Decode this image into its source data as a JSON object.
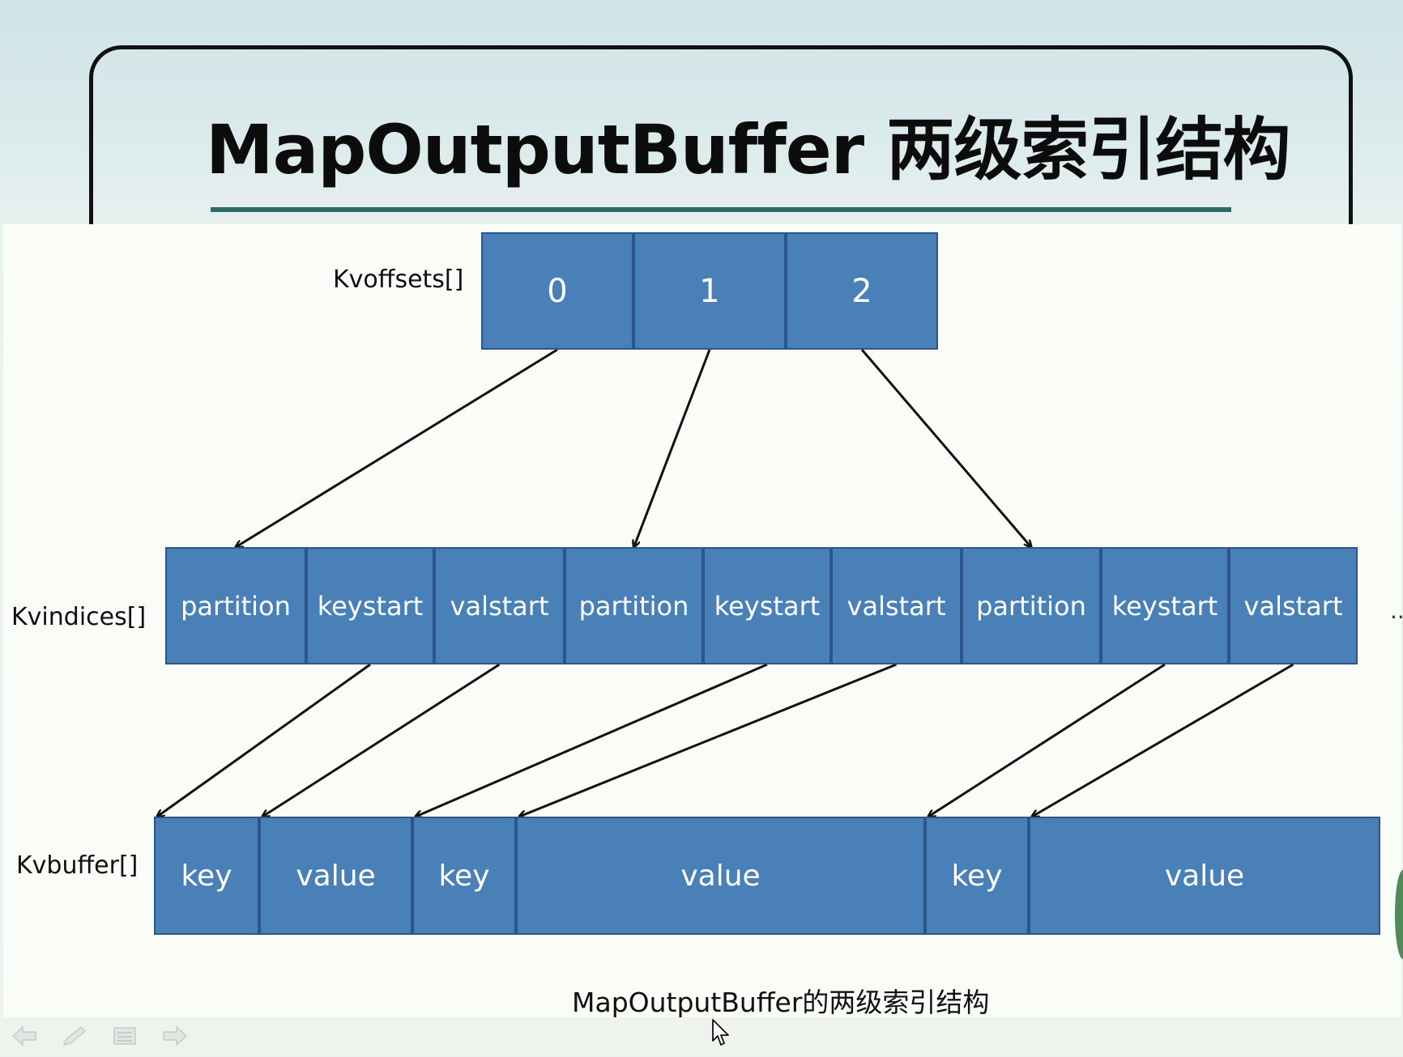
{
  "slide": {
    "title": "MapOutputBuffer 两级索引结构",
    "caption": "MapOutputBuffer的两级索引结构"
  },
  "diagram": {
    "kvoffsets": {
      "label": "Kvoffsets[]",
      "cells": [
        "0",
        "1",
        "2"
      ]
    },
    "kvindices": {
      "label": "Kvindices[]",
      "cells": [
        "partition",
        "keystart",
        "valstart",
        "partition",
        "keystart",
        "valstart",
        "partition",
        "keystart",
        "valstart"
      ],
      "continuation": "..."
    },
    "kvbuffer": {
      "label": "Kvbuffer[]",
      "cells": [
        "key",
        "value",
        "key",
        "value",
        "key",
        "value"
      ]
    },
    "links_offsets_to_indices": [
      [
        0,
        0
      ],
      [
        1,
        3
      ],
      [
        2,
        6
      ]
    ],
    "links_indices_to_buffer": [
      [
        1,
        0
      ],
      [
        2,
        1
      ],
      [
        4,
        2
      ],
      [
        5,
        3
      ],
      [
        7,
        4
      ],
      [
        8,
        5
      ]
    ]
  },
  "icons": {
    "nav": [
      "arrow-left-icon",
      "pen-icon",
      "menu-icon",
      "arrow-right-icon"
    ],
    "pointer": "mouse-cursor-icon"
  },
  "colors": {
    "cell_fill": "#4a80b8",
    "cell_border": "#2b5687",
    "rule": "#2d6b66"
  }
}
